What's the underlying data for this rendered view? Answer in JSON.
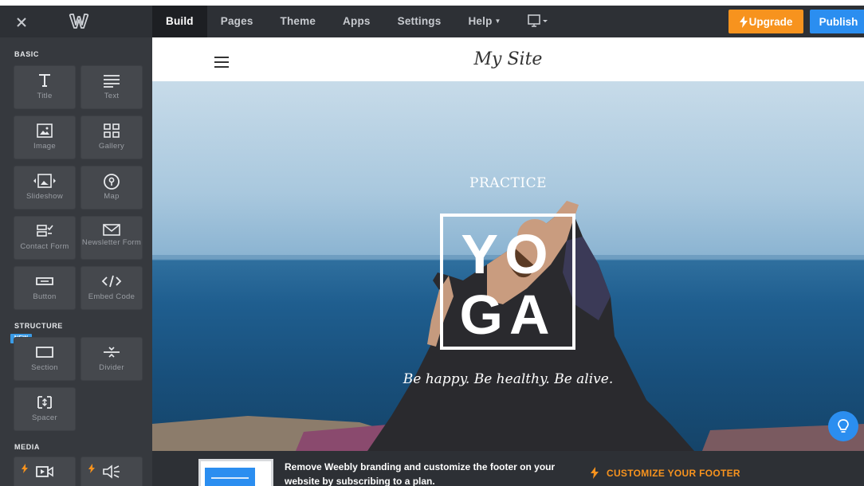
{
  "colors": {
    "topbar": "#2d3035",
    "sidebar": "#36393e",
    "tile": "#45484d",
    "upgrade": "#f7931e",
    "publish": "#2b8ef0"
  },
  "topbar": {
    "close_icon": "close-icon",
    "logo_icon": "weebly-logo",
    "nav": [
      {
        "label": "Build",
        "active": true
      },
      {
        "label": "Pages"
      },
      {
        "label": "Theme"
      },
      {
        "label": "Apps"
      },
      {
        "label": "Settings"
      },
      {
        "label": "Help",
        "dropdown": true
      }
    ],
    "device_icon": "desktop-monitor-icon",
    "upgrade_label": "Upgrade",
    "publish_label": "Publish"
  },
  "sidebar": {
    "sections": {
      "basic": "BASIC",
      "structure": "STRUCTURE",
      "media": "MEDIA"
    },
    "new_badge": "NEW",
    "elements": {
      "title": "Title",
      "text": "Text",
      "image": "Image",
      "gallery": "Gallery",
      "slideshow": "Slideshow",
      "map": "Map",
      "contact_form": "Contact Form",
      "newsletter_form": "Newsletter Form",
      "button": "Button",
      "embed_code": "Embed Code",
      "section": "Section",
      "divider": "Divider",
      "spacer": "Spacer"
    },
    "media_icons": [
      "video-icon",
      "audio-icon"
    ]
  },
  "site": {
    "title": "My Site",
    "hero_kicker": "PRACTICE",
    "hero_word_line1": "YO",
    "hero_word_line2": "GA",
    "hero_tagline": "Be happy. Be healthy. Be alive."
  },
  "upsell": {
    "message": "Remove Weebly branding and customize the footer on your website by subscribing to a plan.",
    "cta": "CUSTOMIZE YOUR FOOTER"
  }
}
